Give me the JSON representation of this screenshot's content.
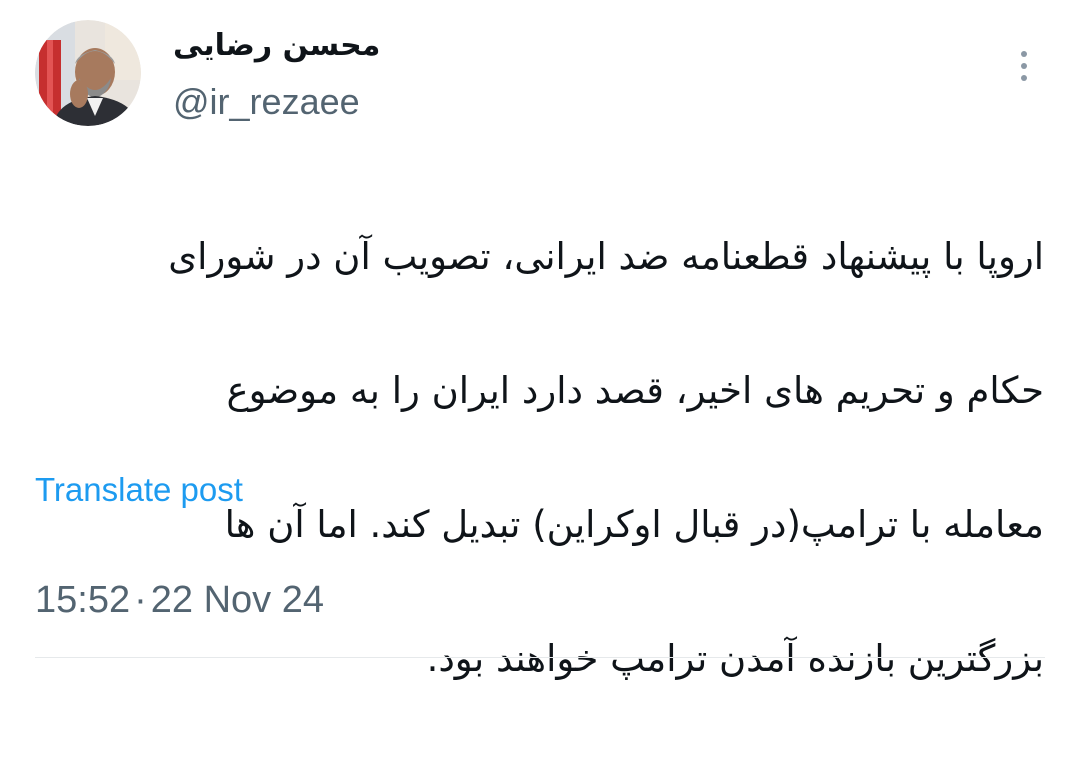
{
  "author": {
    "display_name": "محسن رضایی",
    "handle": "@ir_rezaee",
    "avatar_icon": "profile-photo"
  },
  "tweet": {
    "lines": [
      "اروپا با پیشنهاد قطعنامه ضد ایرانی، تصویب آن در شورای",
      "حکام و تحریم های اخیر، قصد دارد ایران را به موضوع",
      "معامله با ترامپ(در قبال اوکراین) تبدیل کند. اما آن ها",
      "بزرگترین بازنده آمدن ترامپ خواهند بود."
    ]
  },
  "actions": {
    "translate_label": "Translate post",
    "more_icon": "more-vertical-icon"
  },
  "meta": {
    "time": "15:52",
    "separator": "·",
    "date": "22 Nov 24"
  },
  "colors": {
    "link": "#1d9bf0",
    "secondary_text": "#536471",
    "primary_text": "#0f1419"
  }
}
